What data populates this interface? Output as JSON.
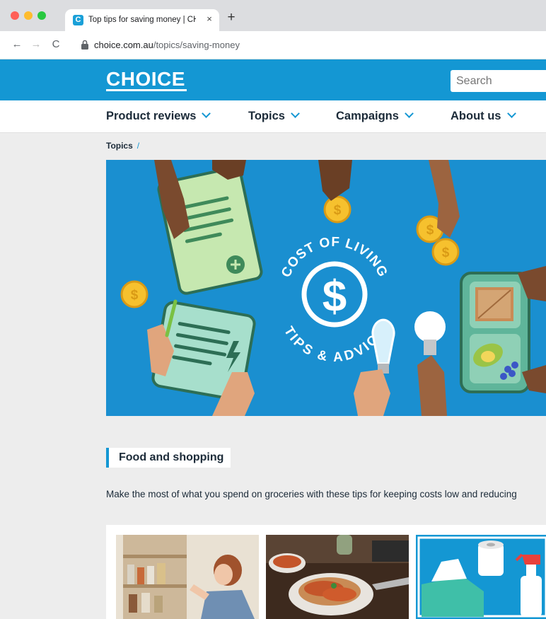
{
  "browser": {
    "tab_title": "Top tips for saving money | CHOICE",
    "tab_favicon": "C",
    "tab_close_icon": "×",
    "new_tab_icon": "+",
    "back_icon": "←",
    "forward_icon": "→",
    "reload_icon": "C",
    "url_domain": "choice.com.au",
    "url_path": "/topics/saving-money"
  },
  "header": {
    "logo": "CHOICE",
    "search_placeholder": "Search"
  },
  "nav": {
    "items": [
      {
        "label": "Product reviews"
      },
      {
        "label": "Topics"
      },
      {
        "label": "Campaigns"
      },
      {
        "label": "About us"
      }
    ]
  },
  "breadcrumb": {
    "item": "Topics",
    "separator": "/"
  },
  "hero": {
    "arc_top": "COST OF LIVING",
    "arc_bottom": "TIPS & ADVICE",
    "currency_symbol": "$",
    "coin_symbol": "$"
  },
  "section": {
    "heading": "Food and shopping",
    "description": "Make the most of what you spend on groceries with these tips for keeping costs low and reducing"
  },
  "colors": {
    "brand_blue": "#1497d3",
    "hero_blue": "#1a8fd0",
    "navy_text": "#1c2b39"
  }
}
